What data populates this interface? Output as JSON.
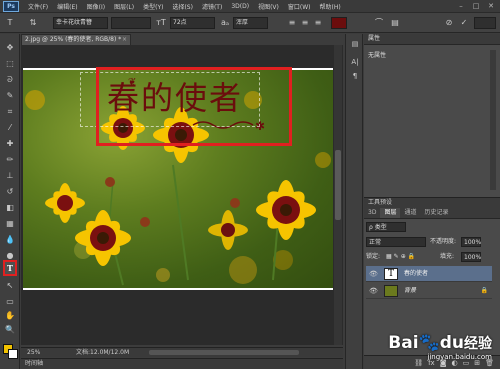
{
  "menu": [
    "文件(F)",
    "编辑(E)",
    "图像(I)",
    "图层(L)",
    "类型(Y)",
    "选择(S)",
    "滤镜(T)",
    "3D(D)",
    "视图(V)",
    "窗口(W)",
    "帮助(H)"
  ],
  "logo": "Ps",
  "options": {
    "font_family": "幸卡花纹青簪",
    "font_size": "72点",
    "antialias": "浑厚",
    "color": "#6b0d0d"
  },
  "document": {
    "tab_title": "2.jpg @ 25% (春的使者, RGB/8) *",
    "canvas_text": "春的使者",
    "text_color": "#6b0d0d",
    "highlight_color": "#e02020"
  },
  "status": {
    "zoom": "25%",
    "doc_info": "文档:12.0M/12.0M",
    "timeline": "时间轴"
  },
  "properties": {
    "title": "属性",
    "empty_text": "无属性"
  },
  "tool_presets": "工具预设",
  "layers_panel": {
    "tabs": [
      "3D",
      "图层",
      "通道",
      "历史记录"
    ],
    "filter": "类型",
    "blend_mode": "正常",
    "opacity_label": "不透明度:",
    "opacity": "100%",
    "lock_label": "锁定:",
    "fill_label": "填充:",
    "fill": "100%",
    "layers": [
      {
        "name": "春的使者",
        "thumb": "T",
        "selected": true
      },
      {
        "name": "背景",
        "thumb": "",
        "selected": false
      }
    ]
  },
  "watermark": {
    "brand": "Bai",
    "paw": "du",
    "suffix": "经验",
    "url": "jingyan.baidu.com"
  }
}
